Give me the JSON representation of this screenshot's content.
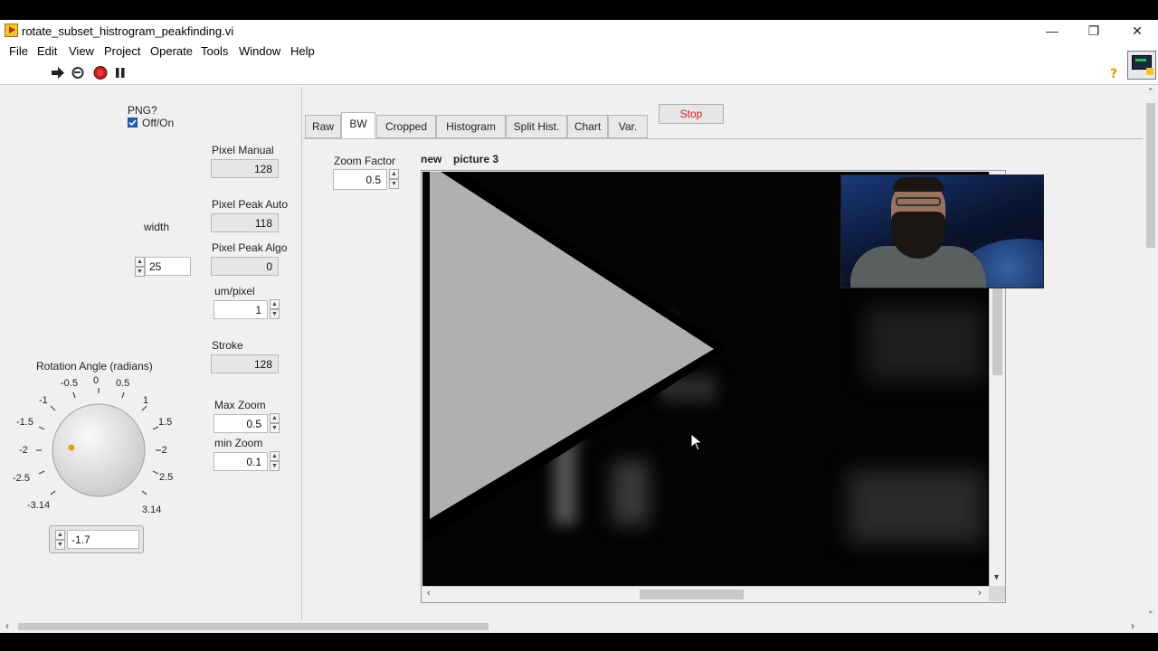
{
  "window": {
    "title": "rotate_subset_histrogram_peakfinding.vi"
  },
  "menu": [
    "File",
    "Edit",
    "View",
    "Project",
    "Operate",
    "Tools",
    "Window",
    "Help"
  ],
  "controls": {
    "png_label": "PNG?",
    "png_checkbox_label": "Off/On",
    "png_checked": true,
    "width_label": "width",
    "width_value": "25",
    "rotation_label": "Rotation Angle (radians)",
    "rotation_value": "-1.7",
    "knob_ticks": [
      "-3.14",
      "-2.5",
      "-2",
      "-1.5",
      "-1",
      "-0.5",
      "0",
      "0.5",
      "1",
      "1.5",
      "-2",
      "2.5",
      "3.14"
    ]
  },
  "indicators": {
    "pixel_manual_label": "Pixel Manual",
    "pixel_manual_value": "128",
    "pixel_peak_auto_label": "Pixel Peak Auto",
    "pixel_peak_auto_value": "118",
    "pixel_peak_algo_label": "Pixel Peak Algo",
    "pixel_peak_algo_value": "0",
    "um_pixel_label": "um/pixel",
    "um_pixel_value": "1",
    "stroke_label": "Stroke",
    "stroke_value": "128",
    "max_zoom_label": "Max Zoom",
    "max_zoom_value": "0.5",
    "min_zoom_label": "min Zoom",
    "min_zoom_value": "0.1"
  },
  "tabs": [
    "Raw",
    "BW",
    "Cropped",
    "Histogram",
    "Split Hist.",
    "Chart",
    "Var."
  ],
  "active_tab": "BW",
  "stop_label": "Stop",
  "zoom_factor_label": "Zoom Factor",
  "zoom_factor_value": "0.5",
  "picture_label": "picture 3",
  "picture_label_prefix": "new",
  "colors": {
    "stop_text": "#d02020",
    "accent": "#1e5fb4",
    "knob_dot": "#e0a020"
  }
}
